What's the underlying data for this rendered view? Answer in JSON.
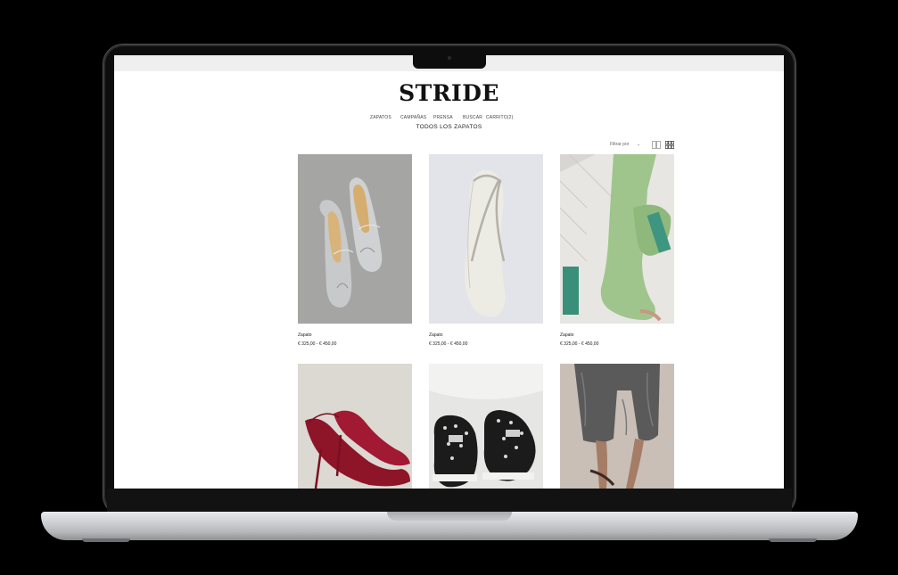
{
  "site": {
    "logo": "STRIDE",
    "nav": [
      "ZAPATOS",
      "CAMPAÑAS",
      "PRENSA",
      "BUSCAR",
      "CARRITO(2)"
    ],
    "subnav": "TODOS LOS ZAPATOS",
    "filter_label": "Filtrar por",
    "filter_caret": "⌄"
  },
  "products": [
    {
      "name": "Zapato",
      "price": "€ 325,00 - € 450,00"
    },
    {
      "name": "Zapato",
      "price": "€ 325,00 - € 450,00"
    },
    {
      "name": "Zapato",
      "price": "€ 325,00 - € 450,00"
    }
  ],
  "icons": [
    "grid-2-icon",
    "grid-3-icon"
  ]
}
